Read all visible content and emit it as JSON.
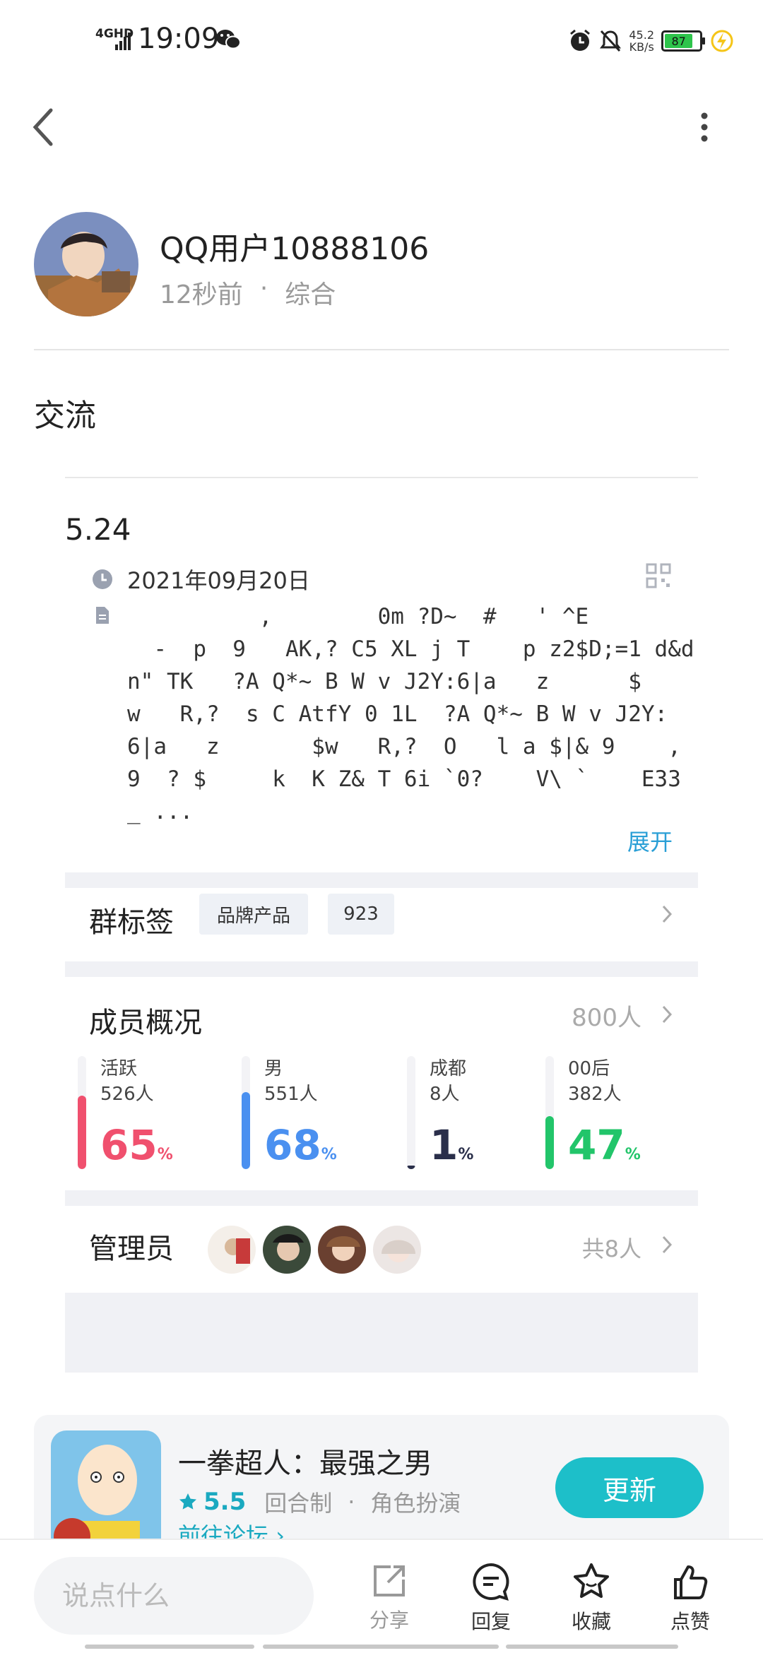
{
  "status_bar": {
    "network": "4GHD",
    "time": "19:09",
    "speed_value": "45.2",
    "speed_unit": "KB/s",
    "battery": "87",
    "icons": [
      "signal-icon",
      "wechat-icon",
      "alarm-icon",
      "mute-icon",
      "battery-icon",
      "charging-icon"
    ]
  },
  "author": {
    "name": "QQ用户10888106",
    "time_ago": "12秒前",
    "separator": "·",
    "category": "综合"
  },
  "post": {
    "title": "交流"
  },
  "group_card": {
    "name": "5.24",
    "date": "2021年09月20日",
    "description": "          ,        0m ?D~  #   ' ^E\n  -  p  9   AK,? C5 XL j T    p z2$D;=1 d&d\nn\" TK   ?A Q*~ B W v J2Y:6|a   z      $\nw   R,?  s C AtfY 0 1L  ?A Q*~ B W v J2Y:\n6|a   z       $w   R,?  O   l a $|& 9    ,\n9  ? $     k  K Z& T 6i `0?    V\\ `    E33\n_ ...",
    "expand_label": "展开",
    "tags_label": "群标签",
    "tags": [
      "品牌产品",
      "923"
    ],
    "members_label": "成员概况",
    "members_total": "800人",
    "stats": [
      {
        "label": "活跃",
        "count": "526人",
        "percent": "65",
        "unit": "%",
        "color": "#f0506e"
      },
      {
        "label": "男",
        "count": "551人",
        "percent": "68",
        "unit": "%",
        "color": "#4a90f0"
      },
      {
        "label": "成都",
        "count": "8人",
        "percent": "1",
        "unit": "%",
        "color": "#2a2f4a"
      },
      {
        "label": "00后",
        "count": "382人",
        "percent": "47",
        "unit": "%",
        "color": "#22c56a"
      }
    ],
    "admins_label": "管理员",
    "admins_total": "共8人"
  },
  "game": {
    "title": "一拳超人：最强之男",
    "score": "5.5",
    "genre1": "回合制",
    "separator": "·",
    "genre2": "角色扮演",
    "forum_link": "前往论坛",
    "update_label": "更新"
  },
  "bottom_bar": {
    "comment_placeholder": "说点什么",
    "share": "分享",
    "reply": "回复",
    "favorite": "收藏",
    "like": "点赞"
  },
  "colors": {
    "accent": "#1dbfc9",
    "link": "#2a9fd6",
    "muted": "#9a9a9a"
  }
}
